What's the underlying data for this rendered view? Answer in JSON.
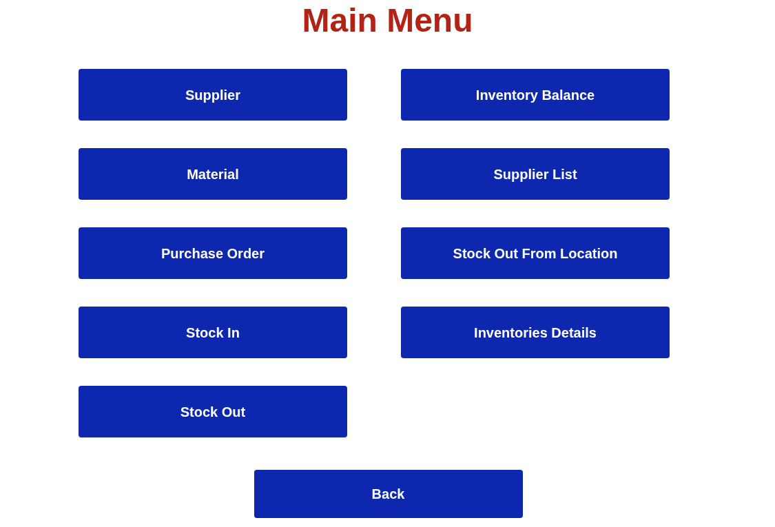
{
  "title": "Main Menu",
  "menu_buttons": [
    "Supplier",
    "Inventory Balance",
    "Material",
    "Supplier List",
    "Purchase Order",
    "Stock Out From Location",
    "Stock In",
    "Inventories Details",
    "Stock Out"
  ],
  "back_button": "Back"
}
